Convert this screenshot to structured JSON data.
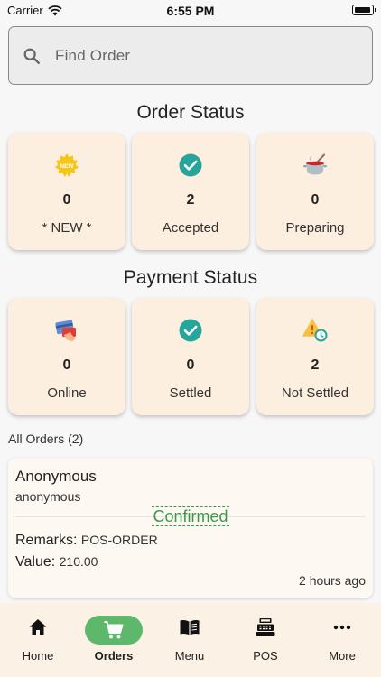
{
  "status_bar": {
    "carrier": "Carrier",
    "time": "6:55 PM"
  },
  "search": {
    "placeholder": "Find Order"
  },
  "order_status": {
    "title": "Order Status",
    "cards": [
      {
        "icon": "new-badge-icon",
        "count": "0",
        "label": "* NEW *"
      },
      {
        "icon": "check-circle-icon",
        "count": "2",
        "label": "Accepted"
      },
      {
        "icon": "cooking-pot-icon",
        "count": "0",
        "label": "Preparing"
      }
    ]
  },
  "payment_status": {
    "title": "Payment Status",
    "cards": [
      {
        "icon": "credit-card-icon",
        "count": "0",
        "label": "Online"
      },
      {
        "icon": "check-circle-icon",
        "count": "0",
        "label": "Settled"
      },
      {
        "icon": "warning-clock-icon",
        "count": "2",
        "label": "Not Settled"
      }
    ]
  },
  "orders": {
    "header": "All Orders (2)",
    "items": [
      {
        "name": "Anonymous",
        "subtitle": "anonymous",
        "status": "Confirmed",
        "remarks_label": "Remarks:",
        "remarks_value": "POS-ORDER",
        "value_label": "Value:",
        "value": "210.00",
        "time": "2 hours ago"
      }
    ]
  },
  "tabbar": {
    "items": [
      {
        "label": "Home",
        "icon": "home-icon"
      },
      {
        "label": "Orders",
        "icon": "cart-icon",
        "active": true
      },
      {
        "label": "Menu",
        "icon": "book-icon"
      },
      {
        "label": "POS",
        "icon": "cash-register-icon"
      },
      {
        "label": "More",
        "icon": "more-dots-icon"
      }
    ]
  },
  "colors": {
    "card_bg": "#fdefe0",
    "accent_green": "#5db86c",
    "confirmed_green": "#3a9a4a",
    "check_teal": "#26a69a",
    "tabbar_bg": "#fcf1e5"
  }
}
